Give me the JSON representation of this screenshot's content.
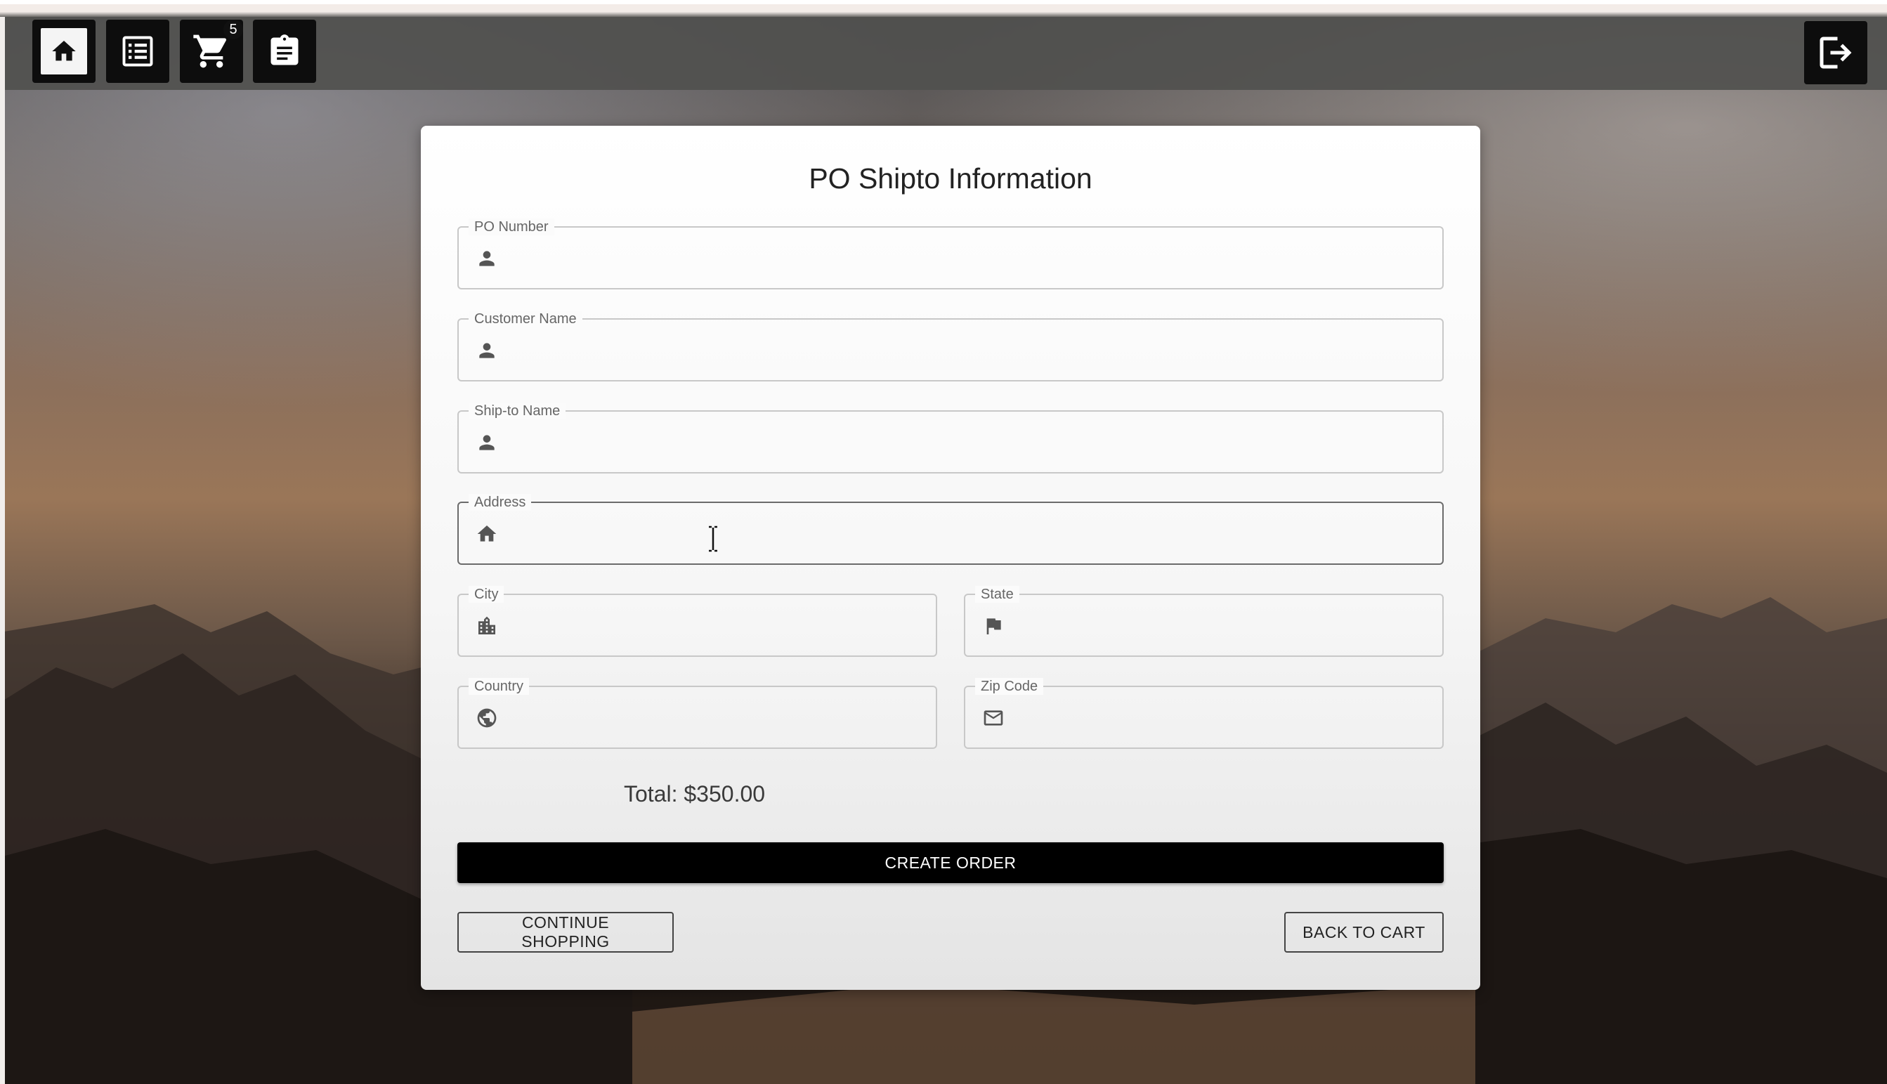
{
  "nav": {
    "cart_count": "5",
    "icons": [
      "home-icon",
      "list-icon",
      "cart-icon",
      "clipboard-icon"
    ],
    "logout_icon": "logout-icon"
  },
  "form": {
    "title": "PO Shipto Information",
    "fields": {
      "po_number": {
        "label": "PO Number",
        "value": "",
        "icon": "person-icon"
      },
      "customer_name": {
        "label": "Customer Name",
        "value": "",
        "icon": "person-icon"
      },
      "shipto_name": {
        "label": "Ship-to Name",
        "value": "",
        "icon": "person-icon"
      },
      "address": {
        "label": "Address",
        "value": "",
        "icon": "home-icon"
      },
      "city": {
        "label": "City",
        "value": "",
        "icon": "city-icon"
      },
      "state": {
        "label": "State",
        "value": "",
        "icon": "flag-icon"
      },
      "country": {
        "label": "Country",
        "value": "",
        "icon": "globe-icon"
      },
      "zip": {
        "label": "Zip Code",
        "value": "",
        "icon": "mail-icon"
      }
    },
    "total": "Total: $350.00",
    "create_order_label": "CREATE ORDER",
    "continue_shopping_label": "CONTINUE SHOPPING",
    "back_to_cart_label": "BACK TO CART"
  },
  "colors": {
    "primary_button": "#000000",
    "nav_button": "#0d0d0d",
    "field_border": "#c8c8c8"
  }
}
